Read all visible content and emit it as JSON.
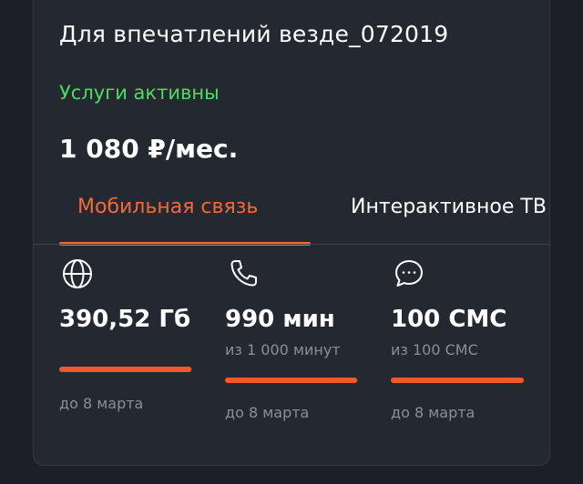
{
  "plan": {
    "name": "Для впечатлений везде_072019",
    "status": "Услуги активны",
    "price": "1 080 ₽/мес."
  },
  "tabs": [
    {
      "label": "Мобильная связь",
      "active": true
    },
    {
      "label": "Интерактивное ТВ",
      "active": false
    }
  ],
  "stats": [
    {
      "icon": "globe-icon",
      "value": "390,52 Гб",
      "sub": "",
      "until": "до 8 марта",
      "progress": 0.99
    },
    {
      "icon": "phone-icon",
      "value": "990 мин",
      "sub": "из 1 000 минут",
      "until": "до 8 марта",
      "progress": 0.99
    },
    {
      "icon": "chat-icon",
      "value": "100 СМС",
      "sub": "из 100 СМС",
      "until": "до 8 марта",
      "progress": 1.0
    }
  ],
  "colors": {
    "accent": "#f26a3c",
    "status_green": "#4ade60",
    "background": "#1c1f26",
    "card": "#242831"
  }
}
